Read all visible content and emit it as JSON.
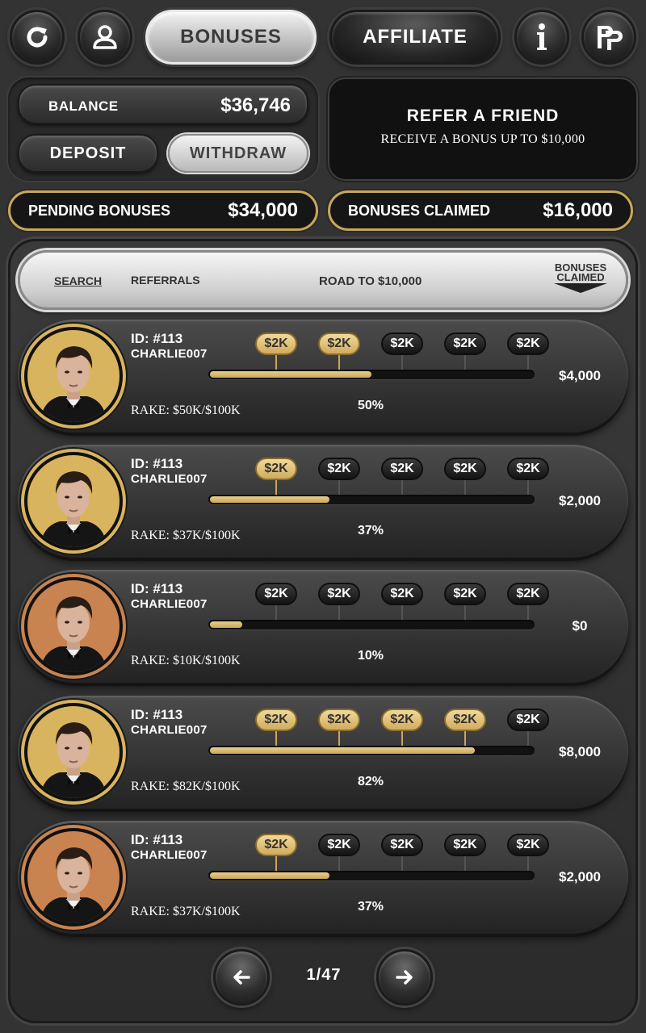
{
  "toolbar": {
    "bonuses_label": "BONUSES",
    "affiliate_label": "AFFILIATE",
    "icons": [
      "refresh-icon",
      "user-icon",
      "info-icon",
      "pp-logo-icon"
    ]
  },
  "account": {
    "balance_label": "BALANCE",
    "balance_value": "$36,746",
    "deposit_label": "DEPOSIT",
    "withdraw_label": "WITHDRAW"
  },
  "refer": {
    "title": "REFER A FRIEND",
    "subtitle": "RECEIVE A BONUS UP TO $10,000"
  },
  "summary": {
    "pending_label": "PENDING BONUSES",
    "pending_value": "$34,000",
    "claimed_label": "BONUSES CLAIMED",
    "claimed_value": "$16,000"
  },
  "table_header": {
    "search": "SEARCH",
    "referrals": "REFERRALS",
    "road": "ROAD TO $10,000",
    "bonuses_claimed_line1": "BONUSES",
    "bonuses_claimed_line2": "CLAIMED"
  },
  "rows": [
    {
      "id": "ID: #113",
      "name": "CHARLIE007",
      "rake": "RAKE: $50K/$100K",
      "progress": 0.5,
      "pct": "50%",
      "amount": "$4,000",
      "milestones": [
        "$2K",
        "$2K",
        "$2K",
        "$2K",
        "$2K"
      ],
      "claimed": 2,
      "ring": "#d9b45e"
    },
    {
      "id": "ID: #113",
      "name": "CHARLIE007",
      "rake": "RAKE: $37K/$100K",
      "progress": 0.37,
      "pct": "37%",
      "amount": "$2,000",
      "milestones": [
        "$2K",
        "$2K",
        "$2K",
        "$2K",
        "$2K"
      ],
      "claimed": 1,
      "ring": "#d9b45e"
    },
    {
      "id": "ID: #113",
      "name": "CHARLIE007",
      "rake": "RAKE: $10K/$100K",
      "progress": 0.1,
      "pct": "10%",
      "amount": "$0",
      "milestones": [
        "$2K",
        "$2K",
        "$2K",
        "$2K",
        "$2K"
      ],
      "claimed": 0,
      "ring": "#c98350"
    },
    {
      "id": "ID: #113",
      "name": "CHARLIE007",
      "rake": "RAKE: $82K/$100K",
      "progress": 0.82,
      "pct": "82%",
      "amount": "$8,000",
      "milestones": [
        "$2K",
        "$2K",
        "$2K",
        "$2K",
        "$2K"
      ],
      "claimed": 4,
      "ring": "#d9b45e"
    },
    {
      "id": "ID: #113",
      "name": "CHARLIE007",
      "rake": "RAKE: $37K/$100K",
      "progress": 0.37,
      "pct": "37%",
      "amount": "$2,000",
      "milestones": [
        "$2K",
        "$2K",
        "$2K",
        "$2K",
        "$2K"
      ],
      "claimed": 1,
      "ring": "#c98350"
    }
  ],
  "pagination": {
    "label": "1/47"
  },
  "colors": {
    "gold": "#c9a65a",
    "background": "#333333"
  }
}
